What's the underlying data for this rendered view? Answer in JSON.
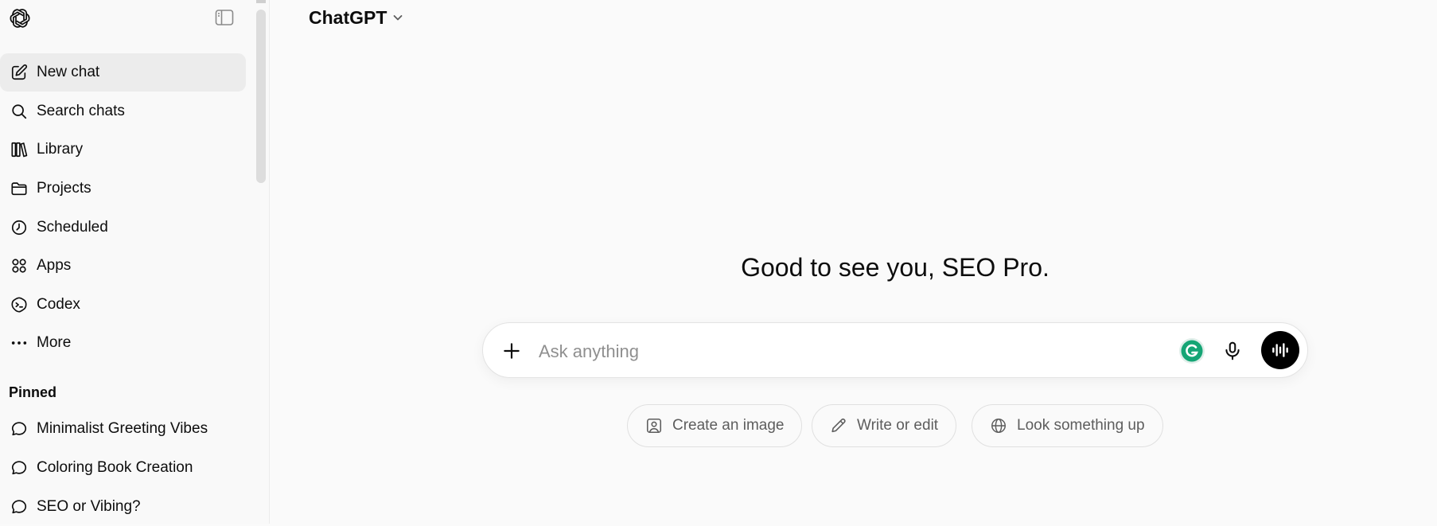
{
  "sidebar": {
    "logo_icon": "openai-logo-icon",
    "toggle_icon": "sidebar-toggle-icon",
    "items": [
      {
        "label": "New chat",
        "icon": "edit-icon"
      },
      {
        "label": "Search chats",
        "icon": "search-icon"
      },
      {
        "label": "Library",
        "icon": "library-icon"
      },
      {
        "label": "Projects",
        "icon": "folder-icon"
      },
      {
        "label": "Scheduled",
        "icon": "clock-icon"
      },
      {
        "label": "Apps",
        "icon": "apps-grid-icon"
      },
      {
        "label": "Codex",
        "icon": "codex-icon"
      },
      {
        "label": "More",
        "icon": "more-dots-icon"
      }
    ],
    "pinned_label": "Pinned",
    "pinned": [
      {
        "label": "Minimalist Greeting Vibes",
        "icon": "chat-bubble-icon"
      },
      {
        "label": "Coloring Book Creation",
        "icon": "chat-bubble-icon"
      },
      {
        "label": "SEO or Vibing?",
        "icon": "chat-bubble-icon"
      }
    ]
  },
  "header": {
    "model_label": "ChatGPT",
    "model_icon": "chevron-down-icon"
  },
  "main": {
    "greeting": "Good to see you, SEO Pro.",
    "composer": {
      "placeholder": "Ask anything",
      "value": "",
      "plus_icon": "plus-icon",
      "grammarly_icon": "grammarly-icon",
      "mic_icon": "microphone-icon",
      "voice_icon": "voice-mode-icon"
    },
    "chips": [
      {
        "label": "Create an image",
        "icon": "image-icon"
      },
      {
        "label": "Write or edit",
        "icon": "pencil-icon"
      },
      {
        "label": "Look something up",
        "icon": "globe-icon"
      }
    ]
  },
  "colors": {
    "background": "#fafafa",
    "sidebar_bg": "#f9f9f9",
    "active_item_bg": "#ececec",
    "voice_button": "#000000",
    "grammarly_green": "#15a575"
  }
}
